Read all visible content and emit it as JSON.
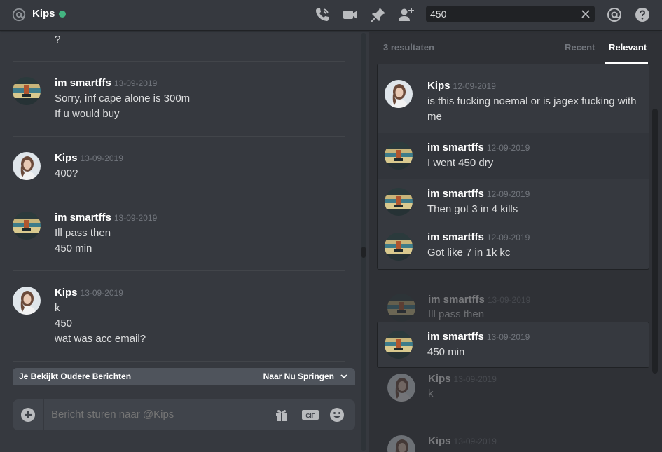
{
  "header": {
    "name": "Kips",
    "status_color": "#43b581",
    "icons": [
      "at-sign-icon",
      "phone-call-icon",
      "video-icon",
      "pin-icon",
      "add-member-icon",
      "mention-icon",
      "help-icon"
    ],
    "search": {
      "value": "450"
    }
  },
  "chat": {
    "top_fragment": "?",
    "messages": [
      {
        "author": "im smartffs",
        "timestamp": "13-09-2019",
        "lines": [
          "Sorry, inf cape alone is 300m",
          "If u would buy"
        ]
      },
      {
        "author": "Kips",
        "timestamp": "13-09-2019",
        "lines": [
          "400?"
        ]
      },
      {
        "author": "im smartffs",
        "timestamp": "13-09-2019",
        "lines": [
          "Ill pass then",
          "450 min"
        ]
      },
      {
        "author": "Kips",
        "timestamp": "13-09-2019",
        "lines": [
          "k",
          "450",
          "wat was acc email?"
        ]
      }
    ],
    "old_messages_bar": {
      "left": "Je Bekijkt Oudere Berichten",
      "right": "Naar Nu Springen"
    },
    "composer": {
      "placeholder": "Bericht sturen naar @Kips",
      "icons": [
        "plus-icon",
        "gift-icon",
        "gif-icon",
        "emoji-icon"
      ]
    }
  },
  "results": {
    "count": "3 resultaten",
    "tabs": [
      {
        "label": "Recent",
        "active": false
      },
      {
        "label": "Relevant",
        "active": true
      }
    ],
    "group1": [
      {
        "author": "Kips",
        "timestamp": "12-09-2019",
        "lines": [
          "is this fucking noemal or is jagex fucking with",
          "me"
        ]
      },
      {
        "author": "im smartffs",
        "timestamp": "12-09-2019",
        "lines": [
          "I went 450 dry"
        ]
      },
      {
        "author": "im smartffs",
        "timestamp": "12-09-2019",
        "lines": [
          "Then got 3 in 4 kills"
        ]
      },
      {
        "author": "im smartffs",
        "timestamp": "12-09-2019",
        "lines": [
          "Got like 7 in 1k kc"
        ]
      }
    ],
    "ctx_before": {
      "author": "im smartffs",
      "timestamp": "13-09-2019",
      "lines": [
        "Ill pass then"
      ]
    },
    "hit": {
      "author": "im smartffs",
      "timestamp": "13-09-2019",
      "lines": [
        "450 min"
      ]
    },
    "ctx_after": [
      {
        "author": "Kips",
        "timestamp": "13-09-2019",
        "lines": [
          "k"
        ]
      },
      {
        "author": "Kips",
        "timestamp": "13-09-2019",
        "lines": []
      }
    ]
  }
}
